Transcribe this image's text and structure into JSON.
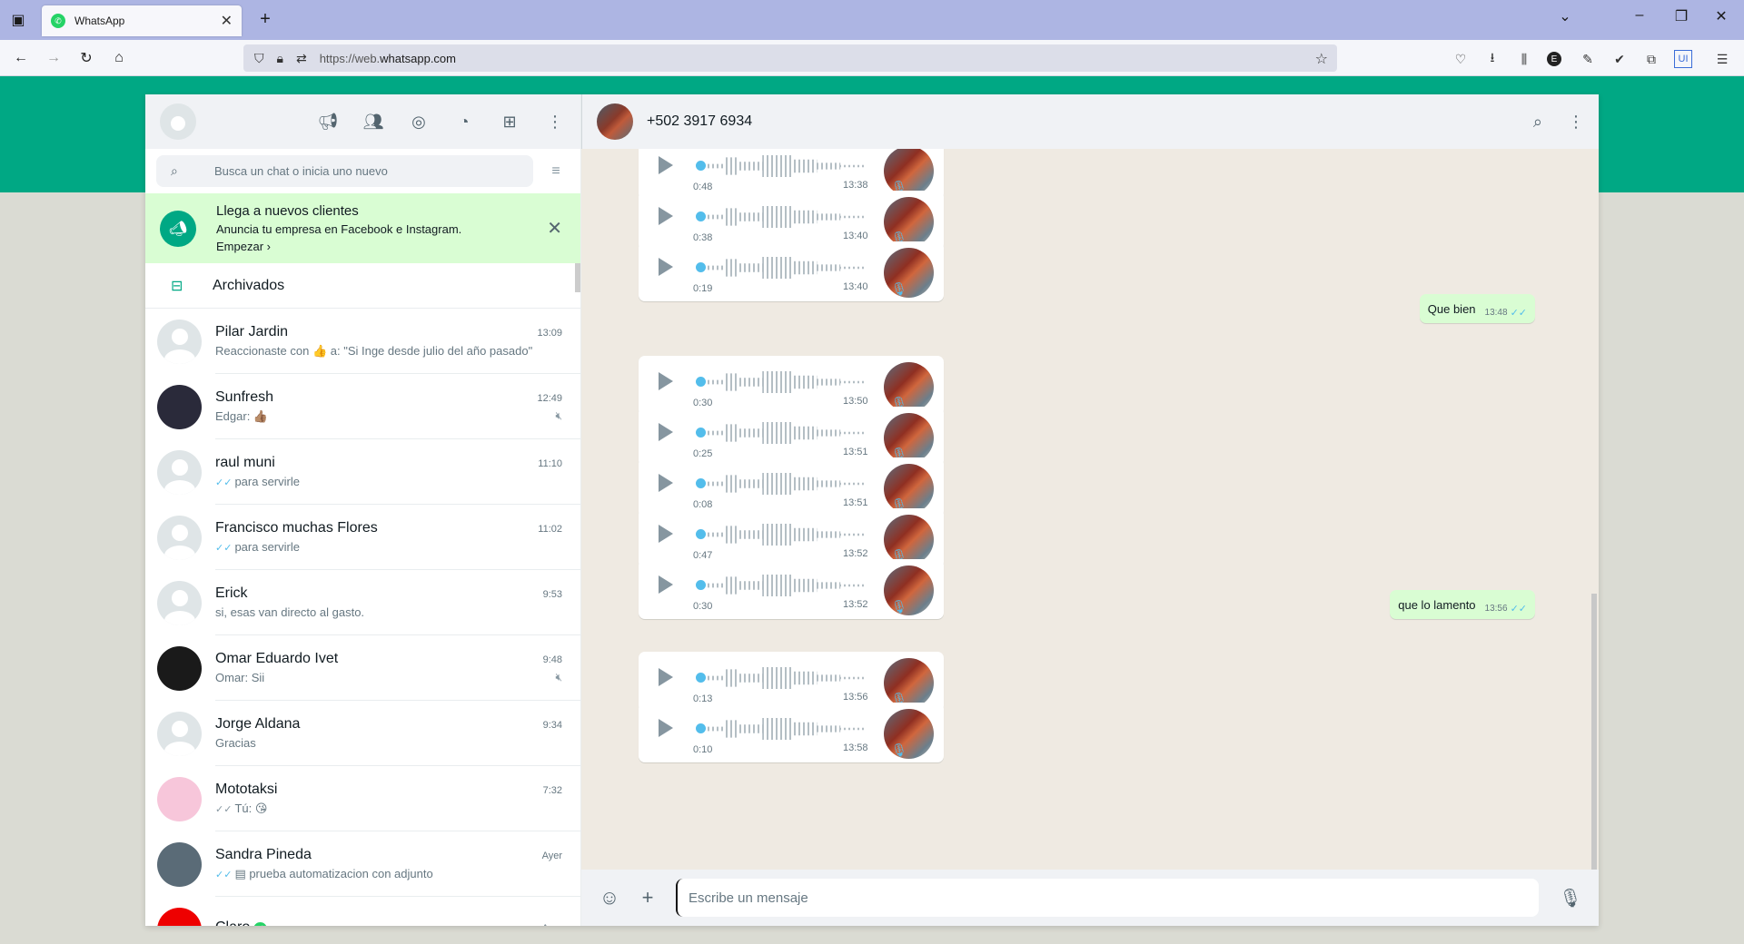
{
  "browser": {
    "tab_title": "WhatsApp",
    "url_prefix": "https://web.",
    "url_host": "whatsapp.com"
  },
  "sidebar": {
    "search_placeholder": "Busca un chat o inicia uno nuevo",
    "promo": {
      "title": "Llega a nuevos clientes",
      "subtitle": "Anuncia tu empresa en Facebook e Instagram.",
      "cta": "Empezar ›"
    },
    "archived_label": "Archivados",
    "chats": [
      {
        "name": "Pilar Jardin",
        "time": "13:09",
        "last": "Reaccionaste con 👍 a: \"Si Inge desde julio del año pasado\"",
        "tick": "",
        "muted": false
      },
      {
        "name": "Sunfresh",
        "time": "12:49",
        "last": "Edgar: 👍🏽",
        "tick": "",
        "muted": true
      },
      {
        "name": "raul muni",
        "time": "11:10",
        "last": "para servirle",
        "tick": "✓✓",
        "muted": false
      },
      {
        "name": "Francisco muchas Flores",
        "time": "11:02",
        "last": "para servirle",
        "tick": "✓✓",
        "muted": false
      },
      {
        "name": "Erick",
        "time": "9:53",
        "last": "si, esas van directo al gasto.",
        "tick": "",
        "muted": false
      },
      {
        "name": "Omar Eduardo Ivet",
        "time": "9:48",
        "last": "Omar: Sii",
        "tick": "",
        "muted": true
      },
      {
        "name": "Jorge Aldana",
        "time": "9:34",
        "last": "Gracias",
        "tick": "",
        "muted": false
      },
      {
        "name": "Mototaksi",
        "time": "7:32",
        "last": "Tú: 😘",
        "tick": "✓✓",
        "muted": false
      },
      {
        "name": "Sandra Pineda",
        "time": "Ayer",
        "last": "▤ prueba automatizacion con adjunto",
        "tick": "✓✓",
        "muted": false
      },
      {
        "name": "Claro",
        "time": "Ayer",
        "last": "",
        "tick": "",
        "muted": false
      }
    ]
  },
  "conversation": {
    "contact": "+502 3917 6934",
    "composer_placeholder": "Escribe un mensaje",
    "voice_notes": [
      {
        "duration": "0:48",
        "time": "13:38"
      },
      {
        "duration": "0:38",
        "time": "13:40"
      },
      {
        "duration": "0:19",
        "time": "13:40"
      },
      {
        "duration": "0:30",
        "time": "13:50"
      },
      {
        "duration": "0:25",
        "time": "13:51"
      },
      {
        "duration": "0:08",
        "time": "13:51"
      },
      {
        "duration": "0:47",
        "time": "13:52"
      },
      {
        "duration": "0:30",
        "time": "13:52"
      },
      {
        "duration": "0:13",
        "time": "13:56"
      },
      {
        "duration": "0:10",
        "time": "13:58"
      }
    ],
    "outgoing": [
      {
        "text": "Que bien",
        "time": "13:48"
      },
      {
        "text": "que lo lamento",
        "time": "13:56"
      }
    ]
  }
}
